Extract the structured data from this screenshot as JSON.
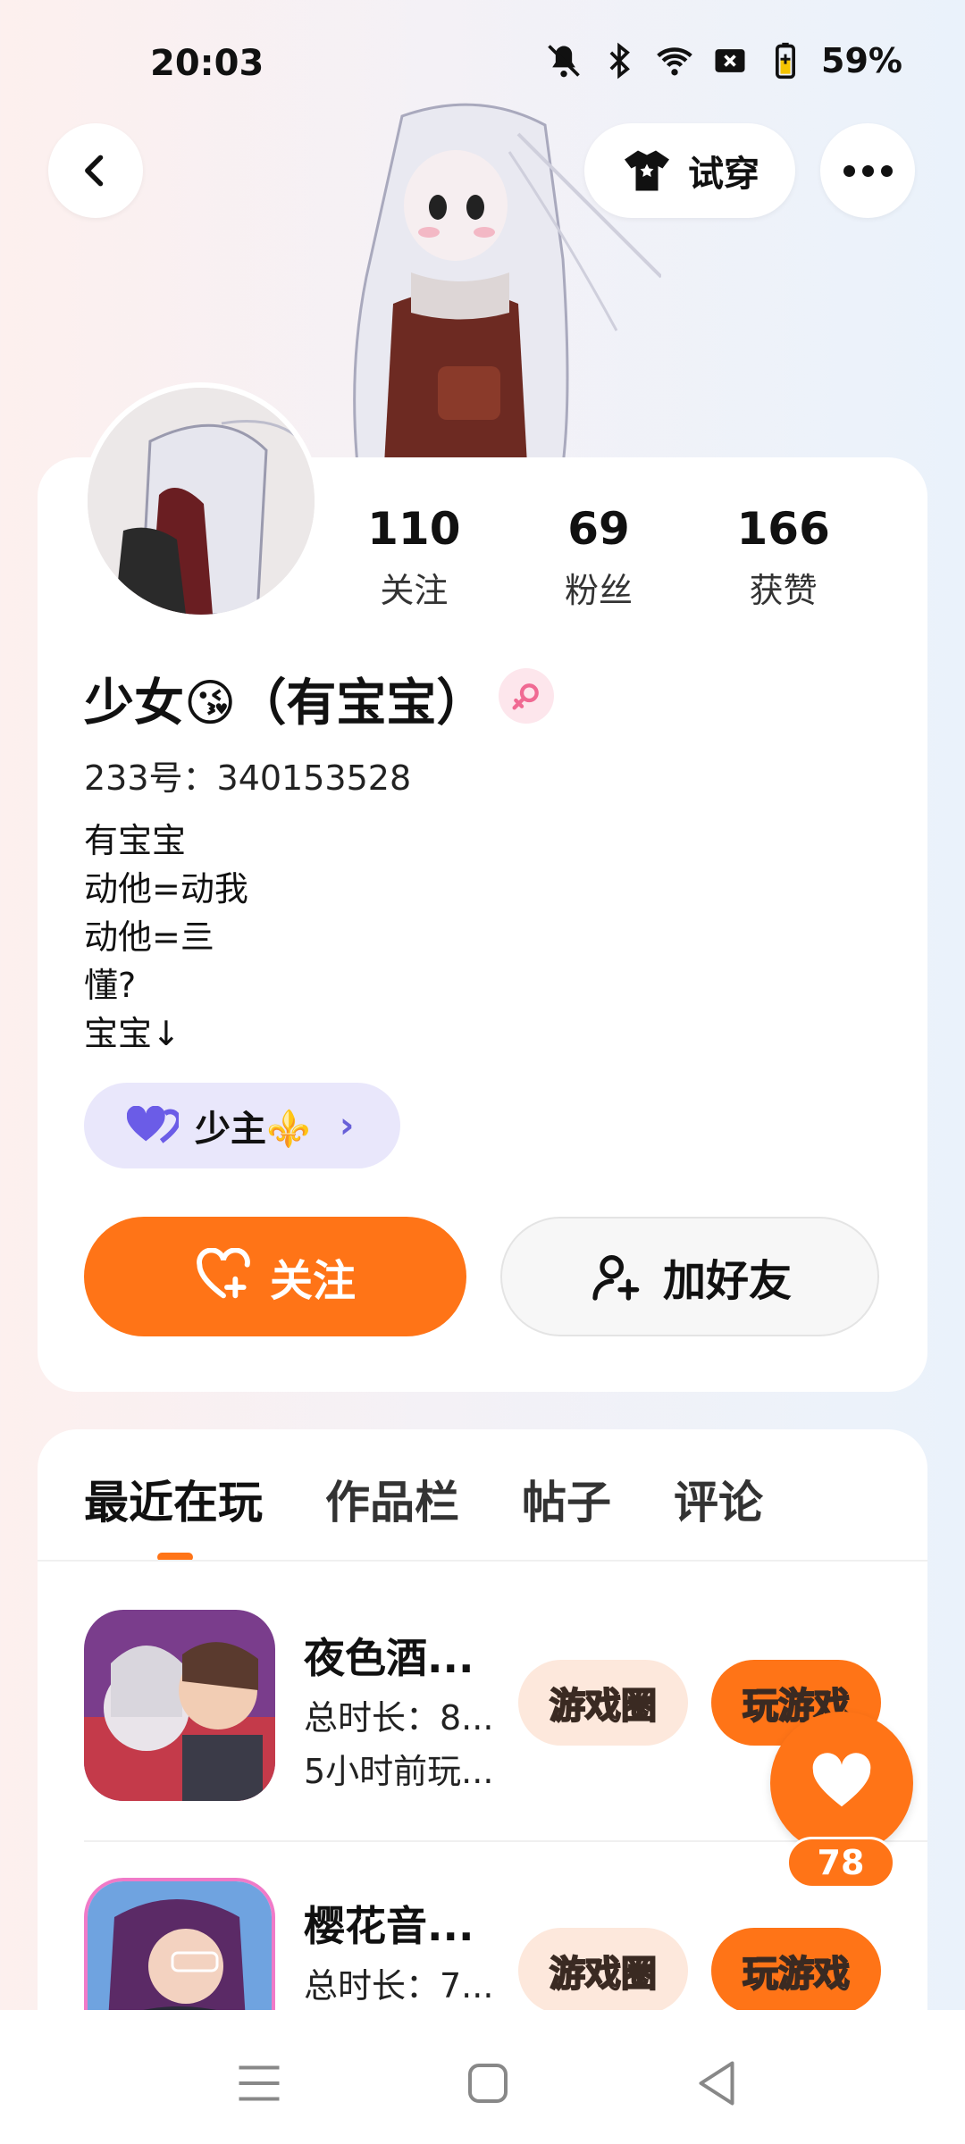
{
  "status_bar": {
    "time": "20:03",
    "battery": "59%",
    "icons": [
      "mute-icon",
      "bluetooth-icon",
      "wifi-icon",
      "sim-off-icon",
      "battery-icon"
    ]
  },
  "header": {
    "tryon_label": "试穿"
  },
  "profile": {
    "stats": [
      {
        "value": "110",
        "label": "关注"
      },
      {
        "value": "69",
        "label": "粉丝"
      },
      {
        "value": "166",
        "label": "获赞"
      }
    ],
    "nickname": "少女😘（有宝宝）",
    "uid": "233号：340153528",
    "bio_lines": [
      "有宝宝",
      "动他=动我",
      "动他=亖",
      "懂?",
      "宝宝↓"
    ],
    "partner_label": "少主⚜️",
    "follow_label": "关注",
    "add_friend_label": "加好友"
  },
  "tabs": [
    "最近在玩",
    "作品栏",
    "帖子",
    "评论"
  ],
  "active_tab": "最近在玩",
  "games": [
    {
      "title": "夜色酒...",
      "duration": "总时长：8...",
      "last_played": "5小时前玩...",
      "circle_label": "游戏圈",
      "play_label": "玩游戏"
    },
    {
      "title": "樱花音...",
      "duration": "总时长：7...",
      "circle_label": "游戏圈",
      "play_label": "玩游戏"
    }
  ],
  "like_fab": {
    "count": "78"
  },
  "colors": {
    "accent": "#ff7417",
    "chip_bg": "#e9e7fb",
    "circle_btn_bg": "#fde8dc"
  }
}
